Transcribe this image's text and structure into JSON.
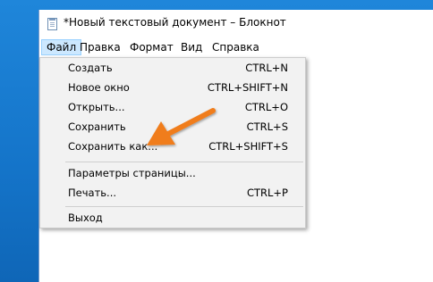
{
  "window": {
    "title": "*Новый текстовый документ – Блокнот"
  },
  "menubar": {
    "items": [
      {
        "label": "Файл",
        "active": true
      },
      {
        "label": "Правка",
        "active": false
      },
      {
        "label": "Формат",
        "active": false
      },
      {
        "label": "Вид",
        "active": false
      },
      {
        "label": "Справка",
        "active": false
      }
    ]
  },
  "file_menu": {
    "items": [
      {
        "label": "Создать",
        "shortcut": "CTRL+N"
      },
      {
        "label": "Новое окно",
        "shortcut": "CTRL+SHIFT+N"
      },
      {
        "label": "Открыть...",
        "shortcut": "CTRL+O"
      },
      {
        "label": "Сохранить",
        "shortcut": "CTRL+S"
      },
      {
        "label": "Сохранить как...",
        "shortcut": "CTRL+SHIFT+S"
      },
      {
        "label": "Параметры страницы...",
        "shortcut": ""
      },
      {
        "label": "Печать...",
        "shortcut": "CTRL+P"
      },
      {
        "label": "Выход",
        "shortcut": ""
      }
    ]
  },
  "colors": {
    "desktop": "#1474c9",
    "menu_bg": "#f2f2f2",
    "active_menu_bg": "#cce8ff",
    "annotation_arrow": "#f07d1a"
  },
  "icons": {
    "title_icon": "notepad-icon",
    "annotation": "orange-arrow-pointer"
  }
}
